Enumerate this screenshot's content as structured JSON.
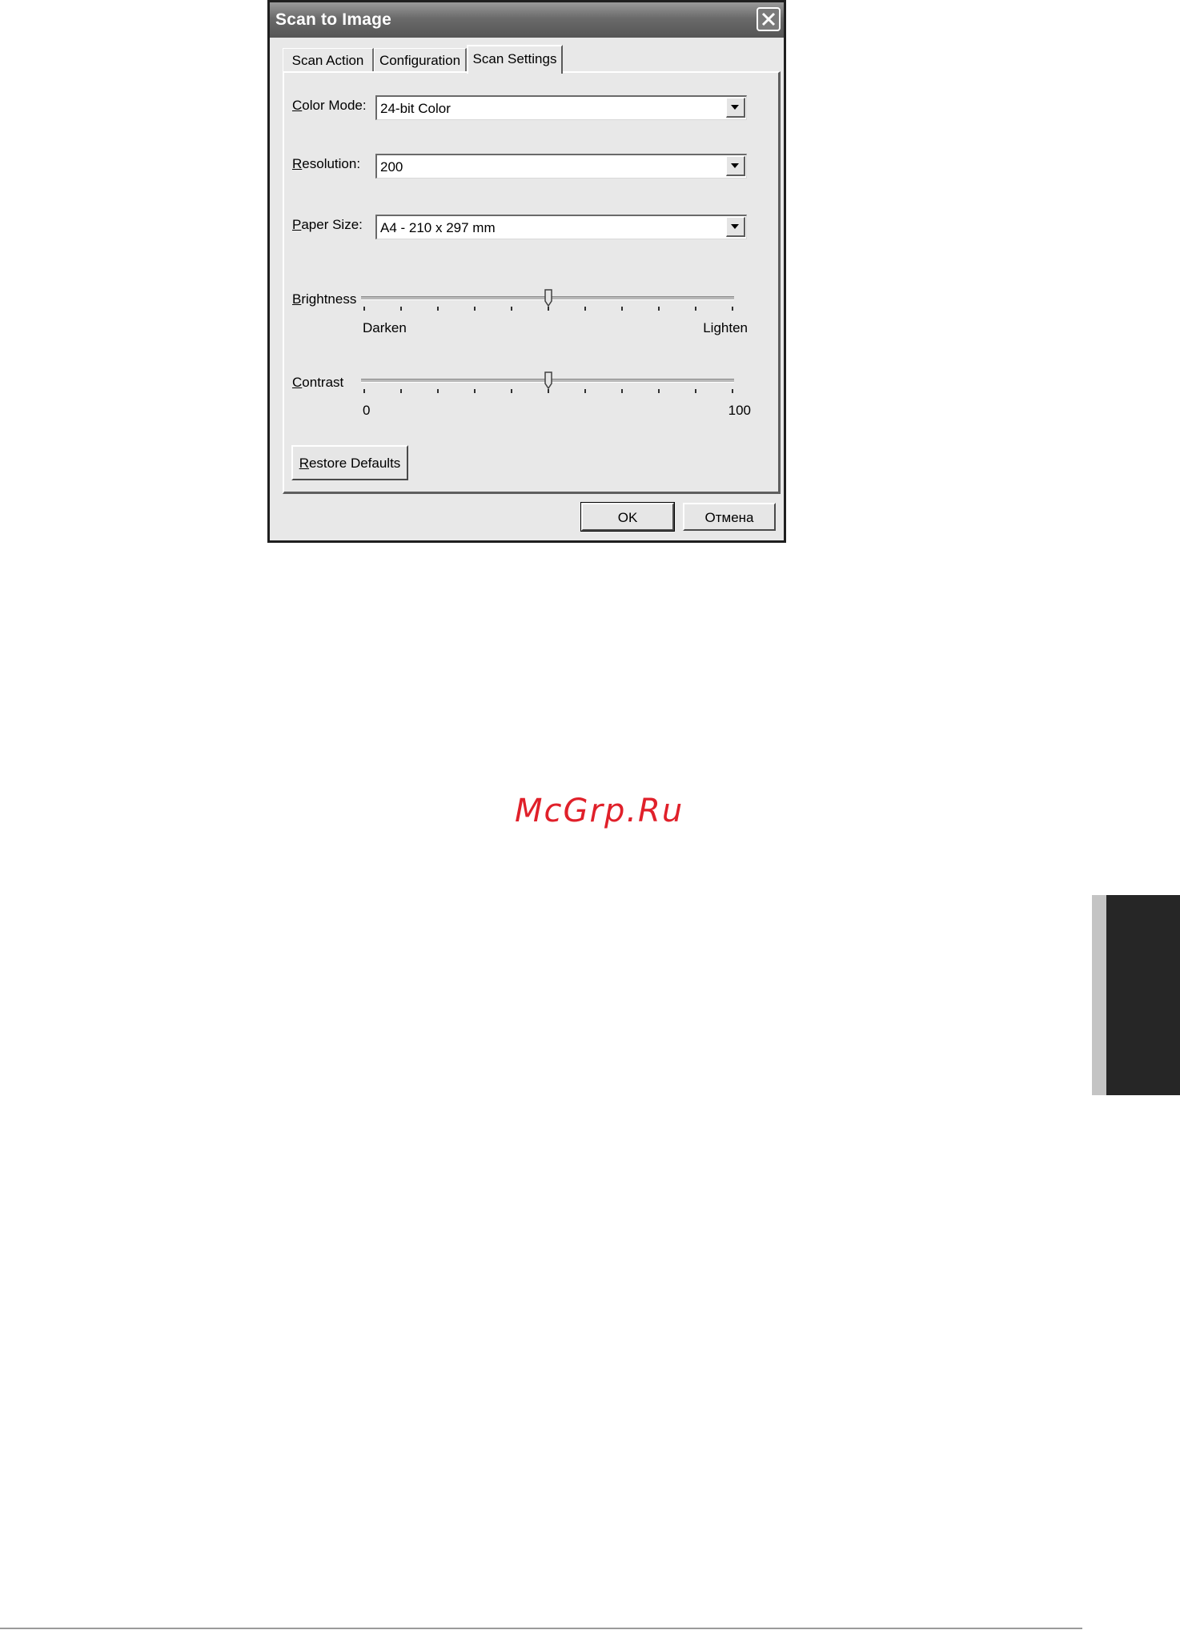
{
  "window": {
    "title": "Scan to Image",
    "close_icon": "close-x-icon"
  },
  "tabs": [
    {
      "label": "Scan Action",
      "active": false
    },
    {
      "label": "Configuration",
      "active": false
    },
    {
      "label": "Scan Settings",
      "active": true
    }
  ],
  "scan_settings": {
    "color_mode": {
      "label_access_key": "C",
      "label_rest": "olor Mode:",
      "value": "24-bit Color"
    },
    "resolution": {
      "label_access_key": "R",
      "label_rest": "esolution:",
      "value": "200"
    },
    "paper_size": {
      "label_access_key": "P",
      "label_rest": "aper Size:",
      "value": "A4 - 210 x 297 mm"
    },
    "brightness": {
      "label_access_key": "B",
      "label_rest": "rightness",
      "min_label": "Darken",
      "max_label": "Lighten",
      "level": 0.5,
      "tick_count": 11
    },
    "contrast": {
      "label_access_key": "C",
      "label_rest": "ontrast",
      "min_label": "0",
      "max_label": "100",
      "level": 0.5,
      "tick_count": 11
    },
    "restore_defaults": {
      "label_access_key": "R",
      "label_rest": "estore Defaults"
    }
  },
  "footer_buttons": {
    "ok": "OK",
    "cancel": "Отмена"
  },
  "page": {
    "watermark": "McGrp.Ru",
    "watermark_color": "#e0202a"
  }
}
